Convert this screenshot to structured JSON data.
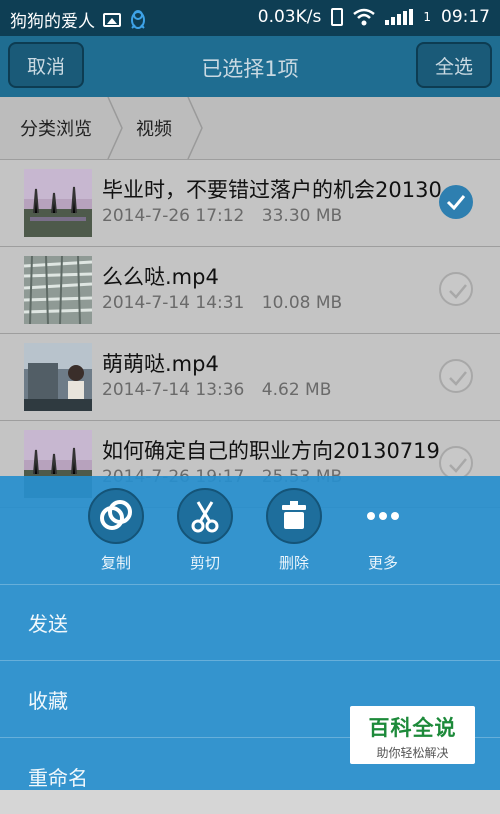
{
  "status_bar": {
    "app_name": "狗狗的爱人",
    "speed": "0.03K/s",
    "sim": "1",
    "time": "09:17"
  },
  "title_bar": {
    "cancel_label": "取消",
    "title": "已选择1项",
    "select_all_label": "全选"
  },
  "breadcrumb": {
    "items": [
      "分类浏览",
      "视频"
    ]
  },
  "files": [
    {
      "name": "毕业时，不要错过落户的机会20130...",
      "date": "2014-7-26 17:12",
      "size": "33.30 MB",
      "selected": true
    },
    {
      "name": "么么哒.mp4",
      "date": "2014-7-14 14:31",
      "size": "10.08 MB",
      "selected": false
    },
    {
      "name": "萌萌哒.mp4",
      "date": "2014-7-14 13:36",
      "size": "4.62 MB",
      "selected": false
    },
    {
      "name": "如何确定自己的职业方向20130719...",
      "date": "2014-7-26 19:17",
      "size": "25.53 MB",
      "selected": false
    }
  ],
  "actions": [
    {
      "label": "复制",
      "icon": "copy-icon"
    },
    {
      "label": "剪切",
      "icon": "scissors-icon"
    },
    {
      "label": "删除",
      "icon": "trash-icon"
    },
    {
      "label": "更多",
      "icon": "more-icon"
    }
  ],
  "menu": {
    "send": "发送",
    "favorite": "收藏",
    "rename": "重命名"
  },
  "watermark": {
    "title": "百科全说",
    "subtitle": "助你轻松解决"
  },
  "colors": {
    "accent": "#2e7fb0",
    "sheet": "#288fce",
    "watermark_green": "#1d8a3a"
  }
}
